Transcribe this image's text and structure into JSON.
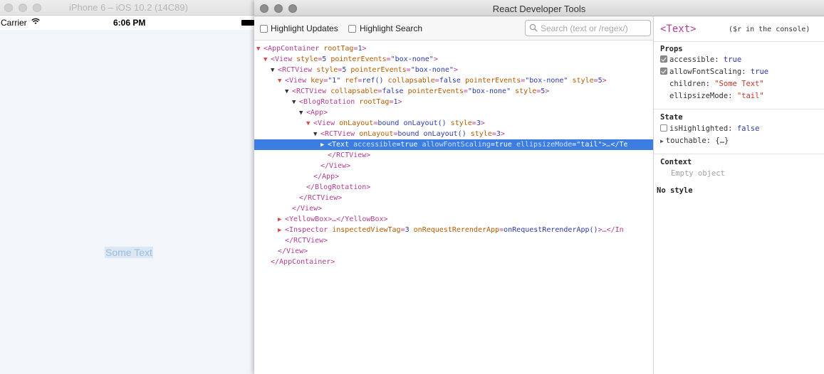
{
  "simulator": {
    "title": "iPhone 6 – iOS 10.2 (14C89)",
    "status_bar": {
      "carrier": "Carrier",
      "time": "6:06 PM"
    },
    "screen_text": "Some Text"
  },
  "devtools": {
    "title": "React Developer Tools",
    "toolbar": {
      "highlight_updates": "Highlight Updates",
      "highlight_search": "Highlight Search",
      "search_placeholder": "Search (text or /regex/)"
    },
    "tree": [
      {
        "indent": 0,
        "arrow": "open",
        "tag": "AppContainer",
        "attrs": [
          [
            "rootTag",
            "1"
          ]
        ],
        "close": false
      },
      {
        "indent": 1,
        "arrow": "open",
        "tag": "View",
        "attrs": [
          [
            "style",
            "5"
          ],
          [
            "pointerEvents",
            "\"box-none\""
          ]
        ],
        "close": false
      },
      {
        "indent": 2,
        "arrow": "open-dark",
        "tag": "RCTView",
        "attrs": [
          [
            "style",
            "5"
          ],
          [
            "pointerEvents",
            "\"box-none\""
          ]
        ],
        "close": false
      },
      {
        "indent": 3,
        "arrow": "open",
        "tag": "View",
        "attrs": [
          [
            "key",
            "\"1\""
          ],
          [
            "ref",
            "ref()"
          ],
          [
            "collapsable",
            "false"
          ],
          [
            "pointerEvents",
            "\"box-none\""
          ],
          [
            "style",
            "5"
          ]
        ],
        "close": false
      },
      {
        "indent": 4,
        "arrow": "open-dark",
        "tag": "RCTView",
        "attrs": [
          [
            "collapsable",
            "false"
          ],
          [
            "pointerEvents",
            "\"box-none\""
          ],
          [
            "style",
            "5"
          ]
        ],
        "close": false
      },
      {
        "indent": 5,
        "arrow": "open-dark",
        "tag": "BlogRotation",
        "attrs": [
          [
            "rootTag",
            "1"
          ]
        ],
        "close": false
      },
      {
        "indent": 6,
        "arrow": "open-dark",
        "tag": "App",
        "attrs": [],
        "close": false
      },
      {
        "indent": 7,
        "arrow": "open",
        "tag": "View",
        "attrs": [
          [
            "onLayout",
            "bound onLayout()"
          ],
          [
            "style",
            "3"
          ]
        ],
        "close": false
      },
      {
        "indent": 8,
        "arrow": "open-dark",
        "tag": "RCTView",
        "attrs": [
          [
            "onLayout",
            "bound onLayout()"
          ],
          [
            "style",
            "3"
          ]
        ],
        "close": false
      },
      {
        "indent": 9,
        "arrow": "closed-selected",
        "tag": "Text",
        "attrs": [
          [
            "accessible",
            "true"
          ],
          [
            "allowFontScaling",
            "true"
          ],
          [
            "ellipsizeMode",
            "\"tail\""
          ]
        ],
        "suffix": ">…</Te",
        "selected": true
      },
      {
        "indent": 9,
        "arrow": "none",
        "closing": "RCTView"
      },
      {
        "indent": 8,
        "arrow": "none",
        "closing": "View"
      },
      {
        "indent": 7,
        "arrow": "none",
        "closing": "App"
      },
      {
        "indent": 6,
        "arrow": "none",
        "closing": "BlogRotation"
      },
      {
        "indent": 5,
        "arrow": "none",
        "closing": "RCTView"
      },
      {
        "indent": 4,
        "arrow": "none",
        "closing": "View"
      },
      {
        "indent": 3,
        "arrow": "closed",
        "tag": "YellowBox",
        "attrs": [],
        "suffix": ">…</YellowBox>"
      },
      {
        "indent": 3,
        "arrow": "closed",
        "tag": "Inspector",
        "attrs": [
          [
            "inspectedViewTag",
            "3"
          ],
          [
            "onRequestRerenderApp",
            "onRequestRerenderApp()"
          ]
        ],
        "suffix": ">…</In"
      },
      {
        "indent": 3,
        "arrow": "none",
        "closing": "RCTView"
      },
      {
        "indent": 2,
        "arrow": "none",
        "closing": "View"
      },
      {
        "indent": 1,
        "arrow": "none",
        "closing": "AppContainer"
      }
    ],
    "side_pane": {
      "component_name": "<Text>",
      "console_hint": "($r in the console)",
      "props_title": "Props",
      "props": [
        {
          "checkbox": "on",
          "key": "accessible",
          "value": "true",
          "type": "bool"
        },
        {
          "checkbox": "on",
          "key": "allowFontScaling",
          "value": "true",
          "type": "bool"
        },
        {
          "checkbox": "none",
          "key": "children",
          "value": "\"Some Text\"",
          "type": "str"
        },
        {
          "checkbox": "none",
          "key": "ellipsizeMode",
          "value": "\"tail\"",
          "type": "str"
        }
      ],
      "state_title": "State",
      "state": [
        {
          "checkbox": "off",
          "key": "isHighlighted",
          "value": "false",
          "type": "bool"
        },
        {
          "checkbox": "expander",
          "key": "touchable",
          "value": "{…}",
          "type": "obj"
        }
      ],
      "context_title": "Context",
      "context_empty": "Empty object",
      "no_style": "No style"
    }
  }
}
